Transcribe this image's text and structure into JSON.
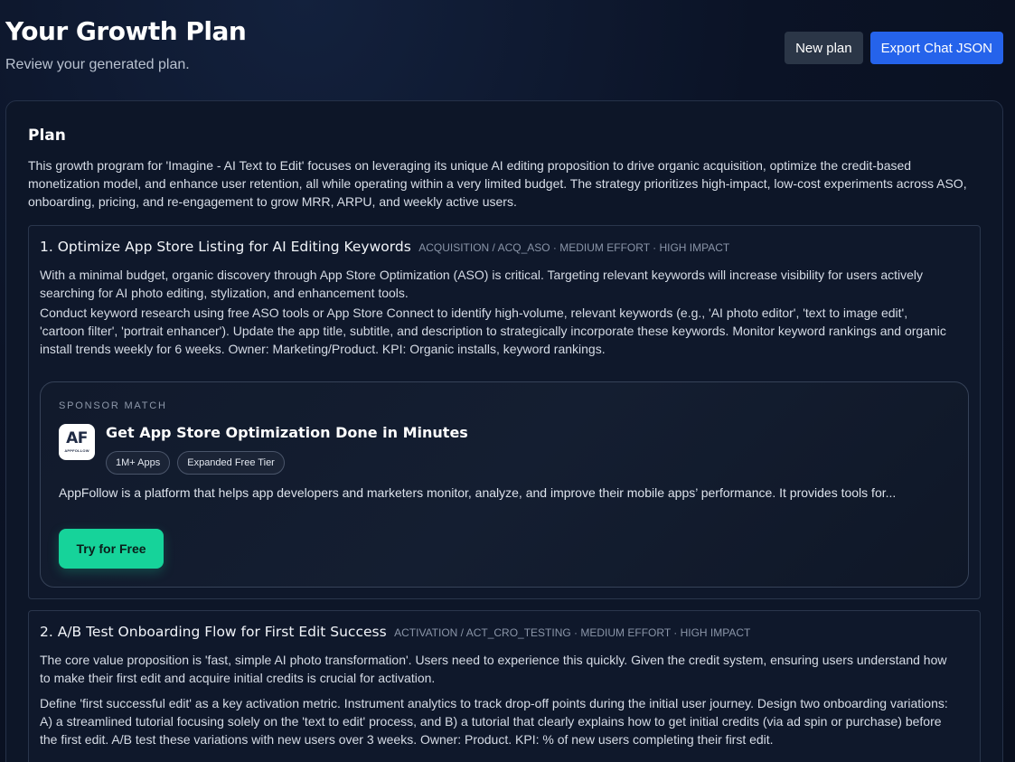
{
  "header": {
    "title": "Your Growth Plan",
    "subtitle": "Review your generated plan."
  },
  "actions": {
    "new_plan": "New plan",
    "export": "Export Chat JSON"
  },
  "colors": {
    "primary": "#2563eb",
    "accent_green": "#16d39a",
    "background": "#0b1326"
  },
  "plan": {
    "heading": "Plan",
    "summary": "This growth program for 'Imagine - AI Text to Edit' focuses on leveraging its unique AI editing proposition to drive organic acquisition, optimize the credit-based monetization model, and enhance user retention, all while operating within a very limited budget. The strategy prioritizes high-impact, low-cost experiments across ASO, onboarding, pricing, and re-engagement to grow MRR, ARPU, and weekly active users.",
    "steps": [
      {
        "title": "1. Optimize App Store Listing for AI Editing Keywords",
        "meta": "ACQUISITION / ACQ_ASO · MEDIUM EFFORT · HIGH IMPACT",
        "rationale": "With a minimal budget, organic discovery through App Store Optimization (ASO) is critical. Targeting relevant keywords will increase visibility for users actively searching for AI photo editing, stylization, and enhancement tools.",
        "details": "Conduct keyword research using free ASO tools or App Store Connect to identify high-volume, relevant keywords (e.g., 'AI photo editor', 'text to image edit', 'cartoon filter', 'portrait enhancer'). Update the app title, subtitle, and description to strategically incorporate these keywords. Monitor keyword rankings and organic install trends weekly for 6 weeks. Owner: Marketing/Product. KPI: Organic installs, keyword rankings."
      },
      {
        "title": "2. A/B Test Onboarding Flow for First Edit Success",
        "meta": "ACTIVATION / ACT_CRO_TESTING · MEDIUM EFFORT · HIGH IMPACT",
        "rationale": "The core value proposition is 'fast, simple AI photo transformation'. Users need to experience this quickly. Given the credit system, ensuring users understand how to make their first edit and acquire initial credits is crucial for activation.",
        "details": "Define 'first successful edit' as a key activation metric. Instrument analytics to track drop-off points during the initial user journey. Design two onboarding variations: A) a streamlined tutorial focusing solely on the 'text to edit' process, and B) a tutorial that clearly explains how to get initial credits (via ad spin or purchase) before the first edit. A/B test these variations with new users over 3 weeks. Owner: Product. KPI: % of new users completing their first edit."
      }
    ]
  },
  "sponsor": {
    "label": "SPONSOR MATCH",
    "logo_letters": "AF",
    "logo_word": "APPFOLLOW",
    "title": "Get App Store Optimization Done in Minutes",
    "tags": [
      "1M+ Apps",
      "Expanded Free Tier"
    ],
    "description": "AppFollow is a platform that helps app developers and marketers monitor, analyze, and improve their mobile apps’ performance. It provides tools for...",
    "cta": "Try for Free"
  }
}
